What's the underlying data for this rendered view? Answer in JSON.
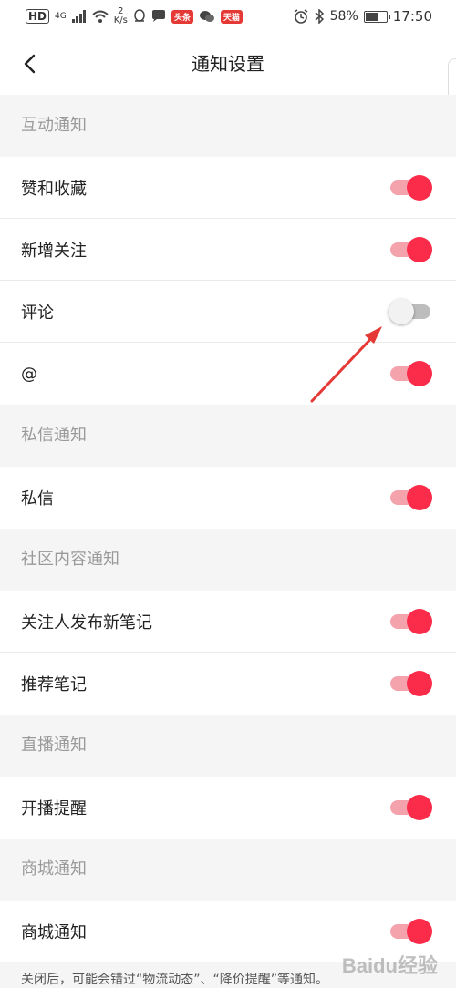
{
  "status_bar": {
    "hd": "HD",
    "network": "4G",
    "speed_value": "2",
    "speed_unit": "K/s",
    "badge_toutiao": "头条",
    "badge_tmall": "天猫",
    "battery": "58%",
    "time": "17:50"
  },
  "header": {
    "title": "通知设置"
  },
  "sections": [
    {
      "title": "互动通知",
      "items": [
        {
          "label": "赞和收藏",
          "enabled": true
        },
        {
          "label": "新增关注",
          "enabled": true
        },
        {
          "label": "评论",
          "enabled": false
        },
        {
          "label": "@",
          "enabled": true
        }
      ]
    },
    {
      "title": "私信通知",
      "items": [
        {
          "label": "私信",
          "enabled": true
        }
      ]
    },
    {
      "title": "社区内容通知",
      "items": [
        {
          "label": "关注人发布新笔记",
          "enabled": true
        },
        {
          "label": "推荐笔记",
          "enabled": true
        }
      ]
    },
    {
      "title": "直播通知",
      "items": [
        {
          "label": "开播提醒",
          "enabled": true
        }
      ]
    },
    {
      "title": "商城通知",
      "items": [
        {
          "label": "商城通知",
          "enabled": true
        }
      ]
    }
  ],
  "footer_note": "关闭后，可能会错过“物流动态”、“降价提醒”等通知。",
  "watermark": "Baidu经验",
  "colors": {
    "toggle_on": "#fb2b4a",
    "toggle_on_track": "#f4a3ad",
    "toggle_off_track": "#bdbdbd",
    "section_bg": "#f5f5f5",
    "annotation_arrow": "#e53935"
  },
  "icons": {
    "back": "chevron-left-icon",
    "alarm": "alarm-icon",
    "bluetooth": "bluetooth-icon",
    "wifi": "wifi-icon",
    "signal": "signal-icon"
  }
}
